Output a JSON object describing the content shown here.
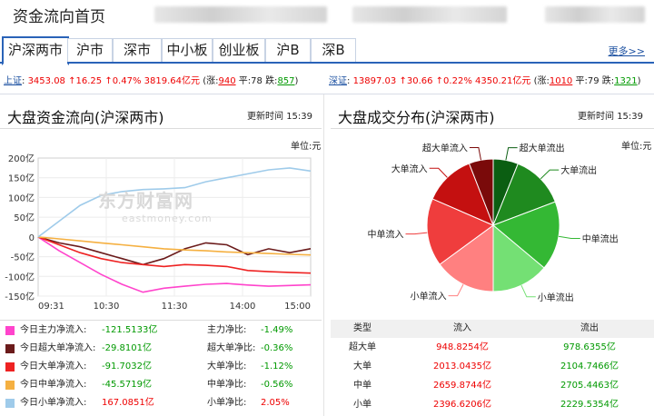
{
  "page": {
    "title": "资金流向首页"
  },
  "tabs": [
    {
      "label": "沪深两市",
      "active": true
    },
    {
      "label": "沪市"
    },
    {
      "label": "深市"
    },
    {
      "label": "中小板"
    },
    {
      "label": "创业板"
    },
    {
      "label": "沪B"
    },
    {
      "label": "深B"
    }
  ],
  "more_link": "更多>>",
  "indices": {
    "sh": {
      "name": "上证",
      "price": "3453.08",
      "chg": "↑16.25",
      "pct": "↑0.47%",
      "amount": "3819.64亿元",
      "up_label": "(涨:",
      "up": "940",
      "flat_label": "平:",
      "flat": "78",
      "down_label": "跌:",
      "down": "857",
      "close": ")"
    },
    "sz": {
      "name": "深证",
      "price": "13897.03",
      "chg": "↑30.66",
      "pct": "↑0.22%",
      "amount": "4350.21亿元",
      "up_label": "(涨:",
      "up": "1010",
      "flat_label": "平:",
      "flat": "79",
      "down_label": "跌:",
      "down": "1321",
      "close": ")"
    }
  },
  "left_panel": {
    "title": "大盘资金流向(沪深两市)",
    "update_label": "更新时间",
    "update_time": "15:39",
    "unit": "单位:元"
  },
  "right_panel": {
    "title": "大盘成交分布(沪深两市)",
    "update_label": "更新时间",
    "update_time": "15:39",
    "unit": "单位:元"
  },
  "watermark": {
    "cn": "东方财富网",
    "en": "eastmoney.com"
  },
  "chart_data": [
    {
      "type": "line",
      "x": [
        "09:31",
        "10:30",
        "11:30",
        "14:00",
        "15:00"
      ],
      "yticks": [
        "200亿",
        "150亿",
        "100亿",
        "50亿",
        "0",
        "-50亿",
        "-100亿",
        "-150亿"
      ],
      "ylim": [
        -150,
        200
      ],
      "series": [
        {
          "name": "今日主力净流入",
          "color": "#ff44cc",
          "values": [
            0,
            -35,
            -65,
            -95,
            -120,
            -140,
            -130,
            -125,
            -120,
            -118,
            -122,
            -125,
            -123,
            -121.5
          ]
        },
        {
          "name": "今日超大单净流入",
          "color": "#6b1b1b",
          "values": [
            0,
            -15,
            -25,
            -40,
            -55,
            -70,
            -55,
            -30,
            -15,
            -20,
            -45,
            -30,
            -40,
            -29.8
          ]
        },
        {
          "name": "今日大单净流入",
          "color": "#ee2222",
          "values": [
            0,
            -20,
            -40,
            -55,
            -65,
            -70,
            -75,
            -70,
            -72,
            -75,
            -85,
            -88,
            -90,
            -91.7
          ]
        },
        {
          "name": "今日中单净流入",
          "color": "#f5b041",
          "values": [
            0,
            -5,
            -10,
            -15,
            -20,
            -25,
            -30,
            -33,
            -35,
            -38,
            -40,
            -42,
            -44,
            -45.6
          ]
        },
        {
          "name": "今日小单净流入",
          "color": "#9fcbea",
          "values": [
            0,
            40,
            80,
            105,
            115,
            120,
            122,
            125,
            140,
            150,
            160,
            170,
            175,
            167.1
          ]
        }
      ]
    },
    {
      "type": "pie",
      "slices": [
        {
          "label": "超大单流出",
          "value": 978.6355,
          "color": "#0b5e12"
        },
        {
          "label": "大单流出",
          "value": 2104.7466,
          "color": "#1f8a1f"
        },
        {
          "label": "中单流出",
          "value": 2705.4463,
          "color": "#34b834"
        },
        {
          "label": "小单流出",
          "value": 2229.5354,
          "color": "#74e074"
        },
        {
          "label": "小单流入",
          "value": 2396.6206,
          "color": "#ff8080"
        },
        {
          "label": "中单流入",
          "value": 2659.8744,
          "color": "#ef3d3d"
        },
        {
          "label": "大单流入",
          "value": 2013.0435,
          "color": "#c41010"
        },
        {
          "label": "超大单流入",
          "value": 948.8254,
          "color": "#7a0a0a"
        }
      ]
    }
  ],
  "legend": [
    {
      "label": "今日主力净流入:",
      "value": "-121.5133亿",
      "value_color": "#090",
      "ratio_label": "主力净比:",
      "ratio": "-1.49%",
      "ratio_color": "#090",
      "swatch": "#ff44cc"
    },
    {
      "label": "今日超大单净流入:",
      "value": "-29.8101亿",
      "value_color": "#090",
      "ratio_label": "超大单净比:",
      "ratio": "-0.36%",
      "ratio_color": "#090",
      "swatch": "#6b1b1b"
    },
    {
      "label": "今日大单净流入:",
      "value": "-91.7032亿",
      "value_color": "#090",
      "ratio_label": "大单净比:",
      "ratio": "-1.12%",
      "ratio_color": "#090",
      "swatch": "#ee2222"
    },
    {
      "label": "今日中单净流入:",
      "value": "-45.5719亿",
      "value_color": "#090",
      "ratio_label": "中单净比:",
      "ratio": "-0.56%",
      "ratio_color": "#090",
      "swatch": "#f5b041"
    },
    {
      "label": "今日小单净流入:",
      "value": "167.0851亿",
      "value_color": "#e00",
      "ratio_label": "小单净比:",
      "ratio": "2.05%",
      "ratio_color": "#e00",
      "swatch": "#9fcbea"
    }
  ],
  "table": {
    "headers": [
      "类型",
      "流入",
      "流出"
    ],
    "rows": [
      {
        "type": "超大单",
        "in": "948.8254亿",
        "out": "978.6355亿"
      },
      {
        "type": "大单",
        "in": "2013.0435亿",
        "out": "2104.7466亿"
      },
      {
        "type": "中单",
        "in": "2659.8744亿",
        "out": "2705.4463亿"
      },
      {
        "type": "小单",
        "in": "2396.6206亿",
        "out": "2229.5354亿"
      }
    ]
  },
  "colors": {
    "accent": "#2a63b8",
    "up": "#e00",
    "down": "#090"
  }
}
